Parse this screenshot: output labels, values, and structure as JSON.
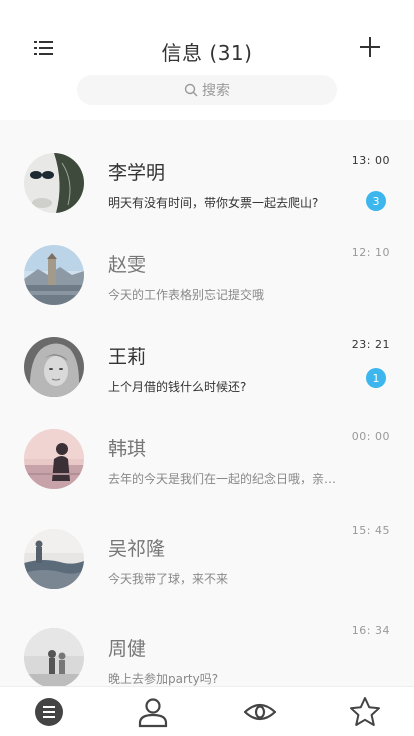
{
  "header": {
    "title": "信息 (31)",
    "search_placeholder": "搜索",
    "menu_icon": "list-icon",
    "add_icon": "plus-icon"
  },
  "messages": [
    {
      "name": "李学明",
      "preview": "明天有没有时间，带你女票一起去爬山?",
      "time": "13: 00",
      "badge": "3",
      "unread": true
    },
    {
      "name": "赵雯",
      "preview": "今天的工作表格别忘记提交哦",
      "time": "12: 10",
      "badge": "",
      "unread": false
    },
    {
      "name": "王莉",
      "preview": "上个月借的钱什么时候还?",
      "time": "23: 21",
      "badge": "1",
      "unread": true
    },
    {
      "name": "韩琪",
      "preview": "去年的今天是我们在一起的纪念日哦，亲…",
      "time": "00: 00",
      "badge": "",
      "unread": false
    },
    {
      "name": "吴祁隆",
      "preview": "今天我带了球，来不来",
      "time": "15: 45",
      "badge": "",
      "unread": false
    },
    {
      "name": "周健",
      "preview": "晚上去参加party吗?",
      "time": "16: 34",
      "badge": "",
      "unread": false
    }
  ],
  "tabbar": {
    "items": [
      "messages-tab-icon",
      "contacts-tab-icon",
      "discover-tab-icon",
      "favorites-tab-icon"
    ],
    "active_color": "#444444",
    "accent": "#3cb6ec"
  }
}
